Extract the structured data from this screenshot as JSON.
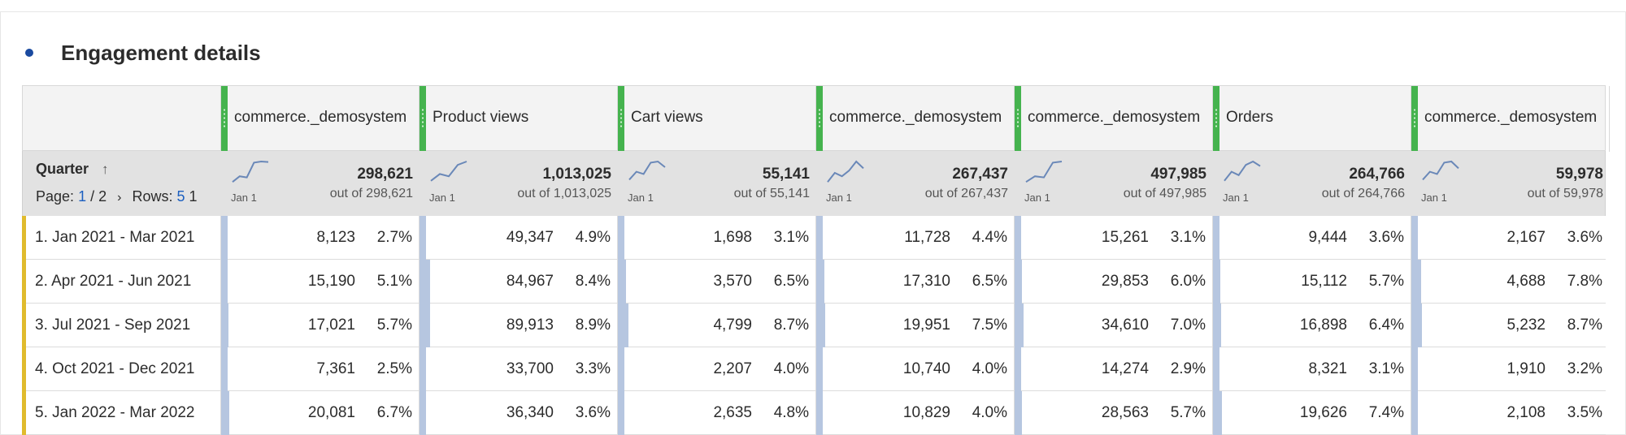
{
  "panel": {
    "title": "Engagement details"
  },
  "dimension": {
    "name": "Quarter",
    "page_label": "Page:",
    "page_current": "1",
    "page_sep": "/ 2",
    "rows_label": "Rows:",
    "rows_value": "5",
    "trailing": "1"
  },
  "columns": [
    {
      "name": "commerce._demosystem",
      "total": "298,621",
      "outof": "out of 298,621",
      "spark_label": "Jan 1",
      "spark": [
        0.1,
        0.35,
        0.3,
        0.95,
        1.0,
        0.98
      ]
    },
    {
      "name": "Product views",
      "total": "1,013,025",
      "outof": "out of 1,013,025",
      "spark_label": "Jan 1",
      "spark": [
        0.15,
        0.45,
        0.35,
        0.85,
        1.0
      ]
    },
    {
      "name": "Cart views",
      "total": "55,141",
      "outof": "out of 55,141",
      "spark_label": "Jan 1",
      "spark": [
        0.2,
        0.55,
        0.45,
        0.95,
        1.0,
        0.75
      ]
    },
    {
      "name": "commerce._demosystem",
      "total": "267,437",
      "outof": "out of 267,437",
      "spark_label": "Jan 1",
      "spark": [
        0.1,
        0.5,
        0.35,
        0.6,
        1.0,
        0.7
      ]
    },
    {
      "name": "commerce._demosystem",
      "total": "497,985",
      "outof": "out of 497,985",
      "spark_label": "Jan 1",
      "spark": [
        0.1,
        0.35,
        0.3,
        0.95,
        1.0
      ]
    },
    {
      "name": "Orders",
      "total": "264,766",
      "outof": "out of 264,766",
      "spark_label": "Jan 1",
      "spark": [
        0.15,
        0.55,
        0.4,
        0.85,
        1.0,
        0.8
      ]
    },
    {
      "name": "commerce._demosystem",
      "total": "59,978",
      "outof": "out of 59,978",
      "spark_label": "Jan 1",
      "spark": [
        0.2,
        0.55,
        0.45,
        0.95,
        1.0,
        0.7
      ]
    }
  ],
  "rows": [
    {
      "label": "1.  Jan 2021 - Mar 2021",
      "cells": [
        {
          "value": "8,123",
          "pct": "2.7%",
          "share": 0.027
        },
        {
          "value": "49,347",
          "pct": "4.9%",
          "share": 0.049
        },
        {
          "value": "1,698",
          "pct": "3.1%",
          "share": 0.031
        },
        {
          "value": "11,728",
          "pct": "4.4%",
          "share": 0.044
        },
        {
          "value": "15,261",
          "pct": "3.1%",
          "share": 0.031
        },
        {
          "value": "9,444",
          "pct": "3.6%",
          "share": 0.036
        },
        {
          "value": "2,167",
          "pct": "3.6%",
          "share": 0.036
        }
      ]
    },
    {
      "label": "2.  Apr 2021 - Jun 2021",
      "cells": [
        {
          "value": "15,190",
          "pct": "5.1%",
          "share": 0.051
        },
        {
          "value": "84,967",
          "pct": "8.4%",
          "share": 0.084
        },
        {
          "value": "3,570",
          "pct": "6.5%",
          "share": 0.065
        },
        {
          "value": "17,310",
          "pct": "6.5%",
          "share": 0.065
        },
        {
          "value": "29,853",
          "pct": "6.0%",
          "share": 0.06
        },
        {
          "value": "15,112",
          "pct": "5.7%",
          "share": 0.057
        },
        {
          "value": "4,688",
          "pct": "7.8%",
          "share": 0.078
        }
      ]
    },
    {
      "label": "3.  Jul 2021 - Sep 2021",
      "cells": [
        {
          "value": "17,021",
          "pct": "5.7%",
          "share": 0.057
        },
        {
          "value": "89,913",
          "pct": "8.9%",
          "share": 0.089
        },
        {
          "value": "4,799",
          "pct": "8.7%",
          "share": 0.087
        },
        {
          "value": "19,951",
          "pct": "7.5%",
          "share": 0.075
        },
        {
          "value": "34,610",
          "pct": "7.0%",
          "share": 0.07
        },
        {
          "value": "16,898",
          "pct": "6.4%",
          "share": 0.064
        },
        {
          "value": "5,232",
          "pct": "8.7%",
          "share": 0.087
        }
      ]
    },
    {
      "label": "4.  Oct 2021 - Dec 2021",
      "cells": [
        {
          "value": "7,361",
          "pct": "2.5%",
          "share": 0.025
        },
        {
          "value": "33,700",
          "pct": "3.3%",
          "share": 0.033
        },
        {
          "value": "2,207",
          "pct": "4.0%",
          "share": 0.04
        },
        {
          "value": "10,740",
          "pct": "4.0%",
          "share": 0.04
        },
        {
          "value": "14,274",
          "pct": "2.9%",
          "share": 0.029
        },
        {
          "value": "8,321",
          "pct": "3.1%",
          "share": 0.031
        },
        {
          "value": "1,910",
          "pct": "3.2%",
          "share": 0.032
        }
      ]
    },
    {
      "label": "5.  Jan 2022 - Mar 2022",
      "cells": [
        {
          "value": "20,081",
          "pct": "6.7%",
          "share": 0.067
        },
        {
          "value": "36,340",
          "pct": "3.6%",
          "share": 0.036
        },
        {
          "value": "2,635",
          "pct": "4.8%",
          "share": 0.048
        },
        {
          "value": "10,829",
          "pct": "4.0%",
          "share": 0.04
        },
        {
          "value": "28,563",
          "pct": "5.7%",
          "share": 0.057
        },
        {
          "value": "19,626",
          "pct": "7.4%",
          "share": 0.074
        },
        {
          "value": "2,108",
          "pct": "3.5%",
          "share": 0.035
        }
      ]
    }
  ],
  "colors": {
    "row_accent": "#e0bb2d",
    "bar": "#b6c6e0",
    "header_drag": "#45b34e",
    "sparkline": "#6a88b8",
    "link": "#1b5fc0"
  }
}
